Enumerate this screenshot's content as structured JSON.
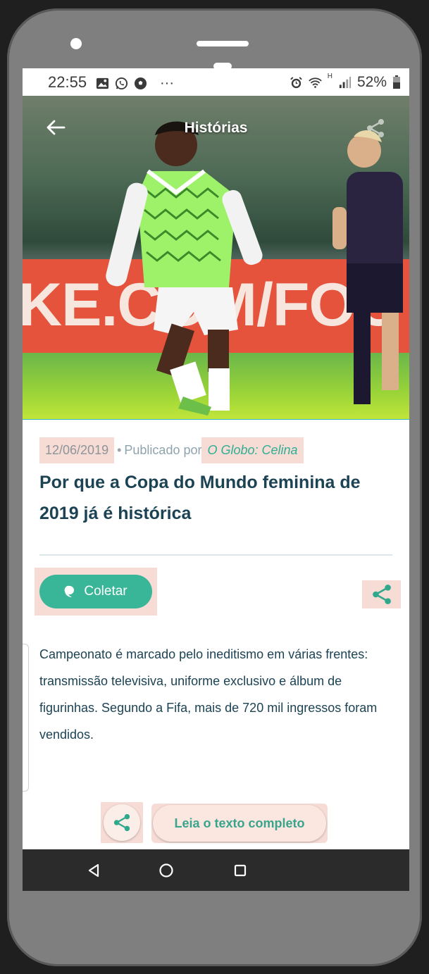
{
  "status_bar": {
    "time": "22:55",
    "more": "···",
    "network": "H",
    "battery": "52%",
    "icons": [
      "image-icon",
      "whatsapp-icon",
      "soccer-ball-icon",
      "alarm-icon",
      "wifi-icon",
      "signal-icon",
      "battery-icon"
    ]
  },
  "app_bar": {
    "title": "Histórias",
    "back_icon": "arrow-left-icon",
    "share_icon": "share-icon"
  },
  "hero": {
    "banner_text": "KE.COM/FOO"
  },
  "article": {
    "date": "12/06/2019",
    "separator": "•",
    "published_by": "Publicado por",
    "source": "O Globo: Celina",
    "title": "Por que a Copa do Mundo feminina de 2019 já é histórica",
    "body": "Campeonato é marcado pelo ineditismo em várias frentes: transmissão televisiva, uniforme exclusivo e álbum de figurinhas. Segundo a Fifa, mais de 720 mil ingressos foram vendidos."
  },
  "actions": {
    "collect_label": "Coletar",
    "read_more_label": "Leia o texto completo"
  },
  "colors": {
    "accent": "#39b597",
    "title_text": "#1c4354",
    "highlight": "#f7dcd5",
    "hero_underline": "#37b7c9"
  }
}
